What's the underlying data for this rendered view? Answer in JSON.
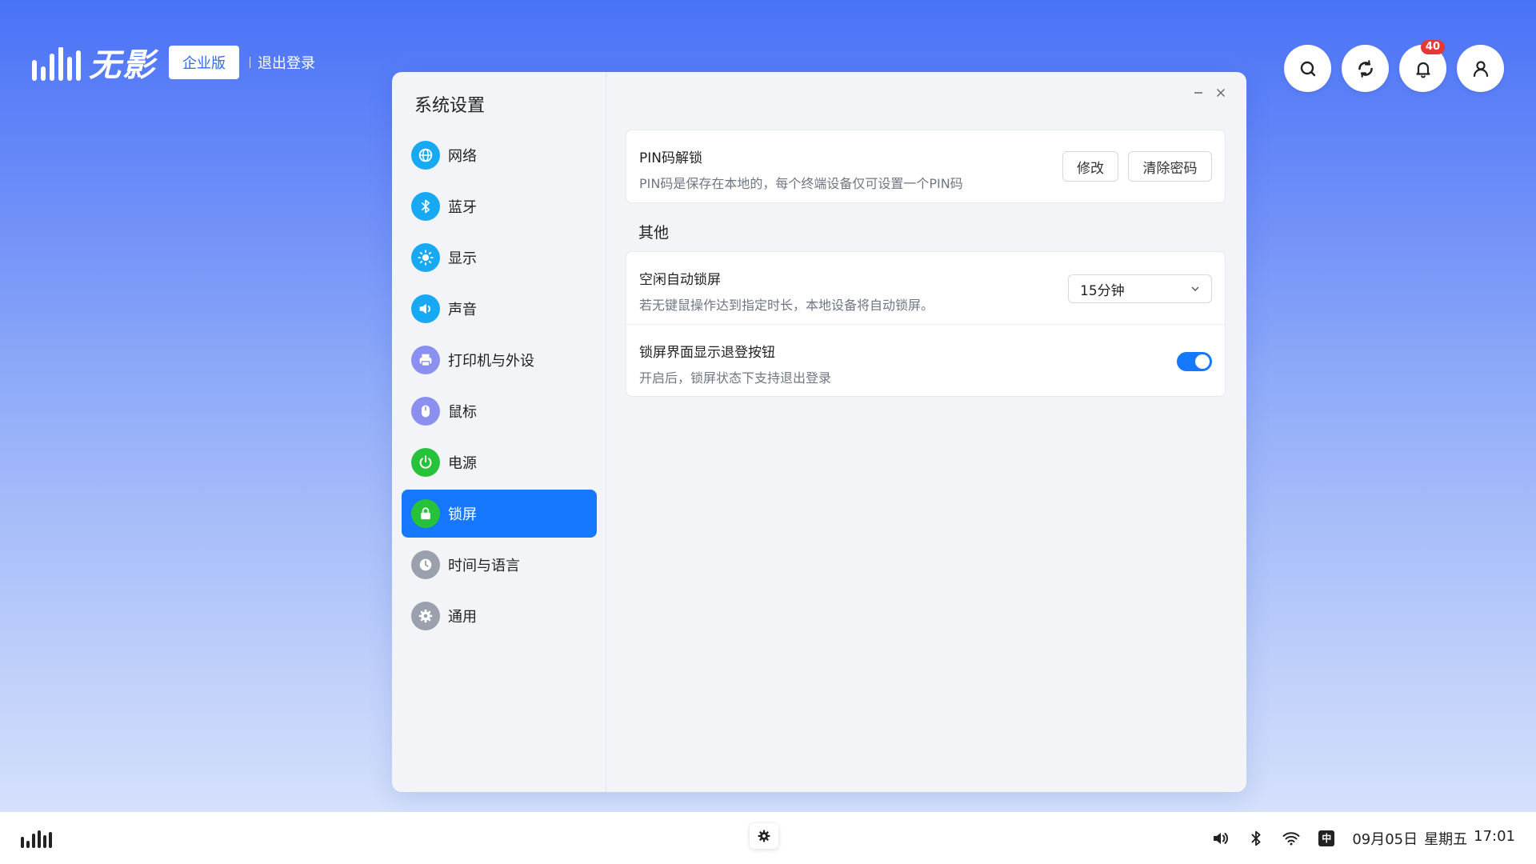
{
  "brand": {
    "name": "无影",
    "edition": "企业版",
    "logout": "退出登录"
  },
  "top_actions": {
    "icons": [
      "search-icon",
      "refresh-icon",
      "bell-icon",
      "user-icon"
    ],
    "notification_count": "40"
  },
  "window": {
    "title": "系统设置",
    "nav": [
      {
        "label": "网络",
        "icon": "globe-icon",
        "color": "#18a9f5"
      },
      {
        "label": "蓝牙",
        "icon": "bluetooth-icon",
        "color": "#18a9f5"
      },
      {
        "label": "显示",
        "icon": "sun-icon",
        "color": "#18a9f5"
      },
      {
        "label": "声音",
        "icon": "speaker-icon",
        "color": "#18a9f5"
      },
      {
        "label": "打印机与外设",
        "icon": "printer-icon",
        "color": "#8b8ff0"
      },
      {
        "label": "鼠标",
        "icon": "mouse-icon",
        "color": "#8b8ff0"
      },
      {
        "label": "电源",
        "icon": "power-icon",
        "color": "#25c23a"
      },
      {
        "label": "锁屏",
        "icon": "lock-icon",
        "color": "#25c23a",
        "active": true
      },
      {
        "label": "时间与语言",
        "icon": "clock-icon",
        "color": "#9aa0ac"
      },
      {
        "label": "通用",
        "icon": "gear-icon",
        "color": "#9aa0ac"
      }
    ],
    "pin": {
      "title": "PIN码解锁",
      "desc": "PIN码是保存在本地的，每个终端设备仅可设置一个PIN码",
      "modify": "修改",
      "clear": "清除密码"
    },
    "other": {
      "section": "其他",
      "idle_lock": {
        "title": "空闲自动锁屏",
        "desc": "若无键鼠操作达到指定时长，本地设备将自动锁屏。",
        "value": "15分钟"
      },
      "logout_button": {
        "title": "锁屏界面显示退登按钮",
        "desc": "开启后，锁屏状态下支持退出登录",
        "enabled": true
      }
    }
  },
  "taskbar": {
    "date": "09月05日",
    "weekday": "星期五",
    "time": "17:01",
    "ime": "中",
    "tray_icons": [
      "volume-icon",
      "bluetooth-icon",
      "wifi-icon",
      "ime-icon"
    ]
  },
  "colors": {
    "accent": "#1677ff",
    "badge": "#e53935"
  }
}
